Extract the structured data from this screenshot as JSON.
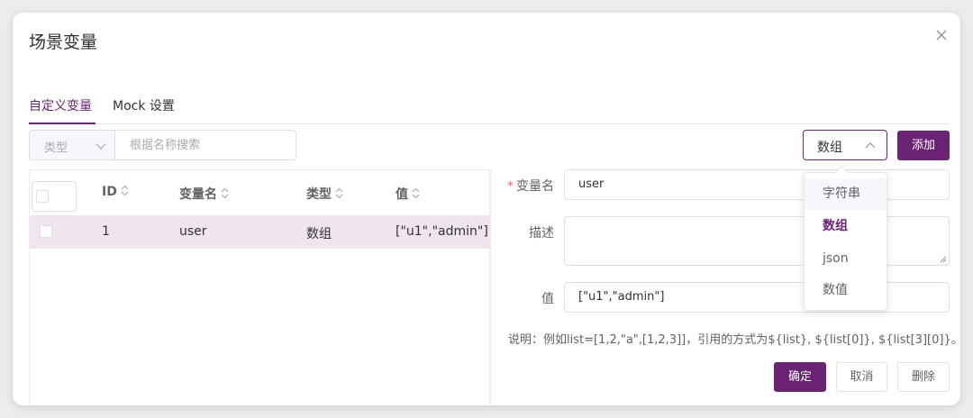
{
  "dialog": {
    "title": "场景变量"
  },
  "tabs": [
    {
      "label": "自定义变量",
      "active": true
    },
    {
      "label": "Mock 设置",
      "active": false
    }
  ],
  "toolbar": {
    "type_filter_placeholder": "类型",
    "search_placeholder": "根据名称搜索",
    "type_select_value": "数组",
    "add_label": "添加"
  },
  "table": {
    "columns": [
      "ID",
      "变量名",
      "类型",
      "值"
    ],
    "rows": [
      {
        "id": "1",
        "name": "user",
        "type": "数组",
        "value": "[\"u1\",\"admin\"]"
      }
    ]
  },
  "form": {
    "name_label": "变量名",
    "name_value": "user",
    "desc_label": "描述",
    "desc_value": "",
    "value_label": "值",
    "value_value": "[\"u1\",\"admin\"]",
    "note": "说明：例如list=[1,2,\"a\",[1,2,3]]，引用的方式为${list}, ${list[0]}, ${list[3][0]}。",
    "confirm_label": "确定",
    "cancel_label": "取消",
    "delete_label": "删除"
  },
  "type_dropdown": {
    "options": [
      "字符串",
      "数组",
      "json",
      "数值"
    ],
    "selected": "数组",
    "hovered": "字符串"
  },
  "colors": {
    "accent": "#6b2474",
    "row_highlight": "#f0e5ef",
    "required": "#f56c6c"
  }
}
